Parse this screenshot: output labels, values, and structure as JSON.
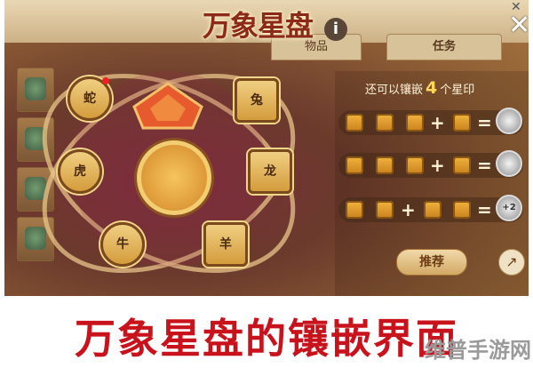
{
  "header": {
    "title": "万象星盘",
    "info_label": "i",
    "close_label": "✕",
    "corner_close": "✕",
    "tabs": [
      {
        "label": "物品"
      },
      {
        "label": "任务"
      }
    ]
  },
  "panel": {
    "count_prefix": "还可以镶嵌",
    "count_value": "4",
    "count_suffix": "个星印",
    "rows": [
      {
        "op1": "+",
        "op2": "=",
        "result": ""
      },
      {
        "op1": "+",
        "op2": "=",
        "result": ""
      },
      {
        "op1": "+",
        "op2": "=",
        "result": "+2"
      }
    ],
    "recommend_label": "推荐",
    "share_label": "↗"
  },
  "star_board": {
    "nodes": [
      {
        "label": "蛇",
        "has_alert": true
      },
      {
        "label": "兔"
      },
      {
        "label": "虎"
      },
      {
        "label": "龙"
      },
      {
        "label": "牛"
      },
      {
        "label": "羊"
      }
    ]
  },
  "caption": "万象星盘的镶嵌界面",
  "watermark": "维普手游网",
  "colors": {
    "caption": "#c8131d",
    "slot": "#f3b43e",
    "accent_number": "#ffd75a",
    "background": "#6b3a2c"
  }
}
